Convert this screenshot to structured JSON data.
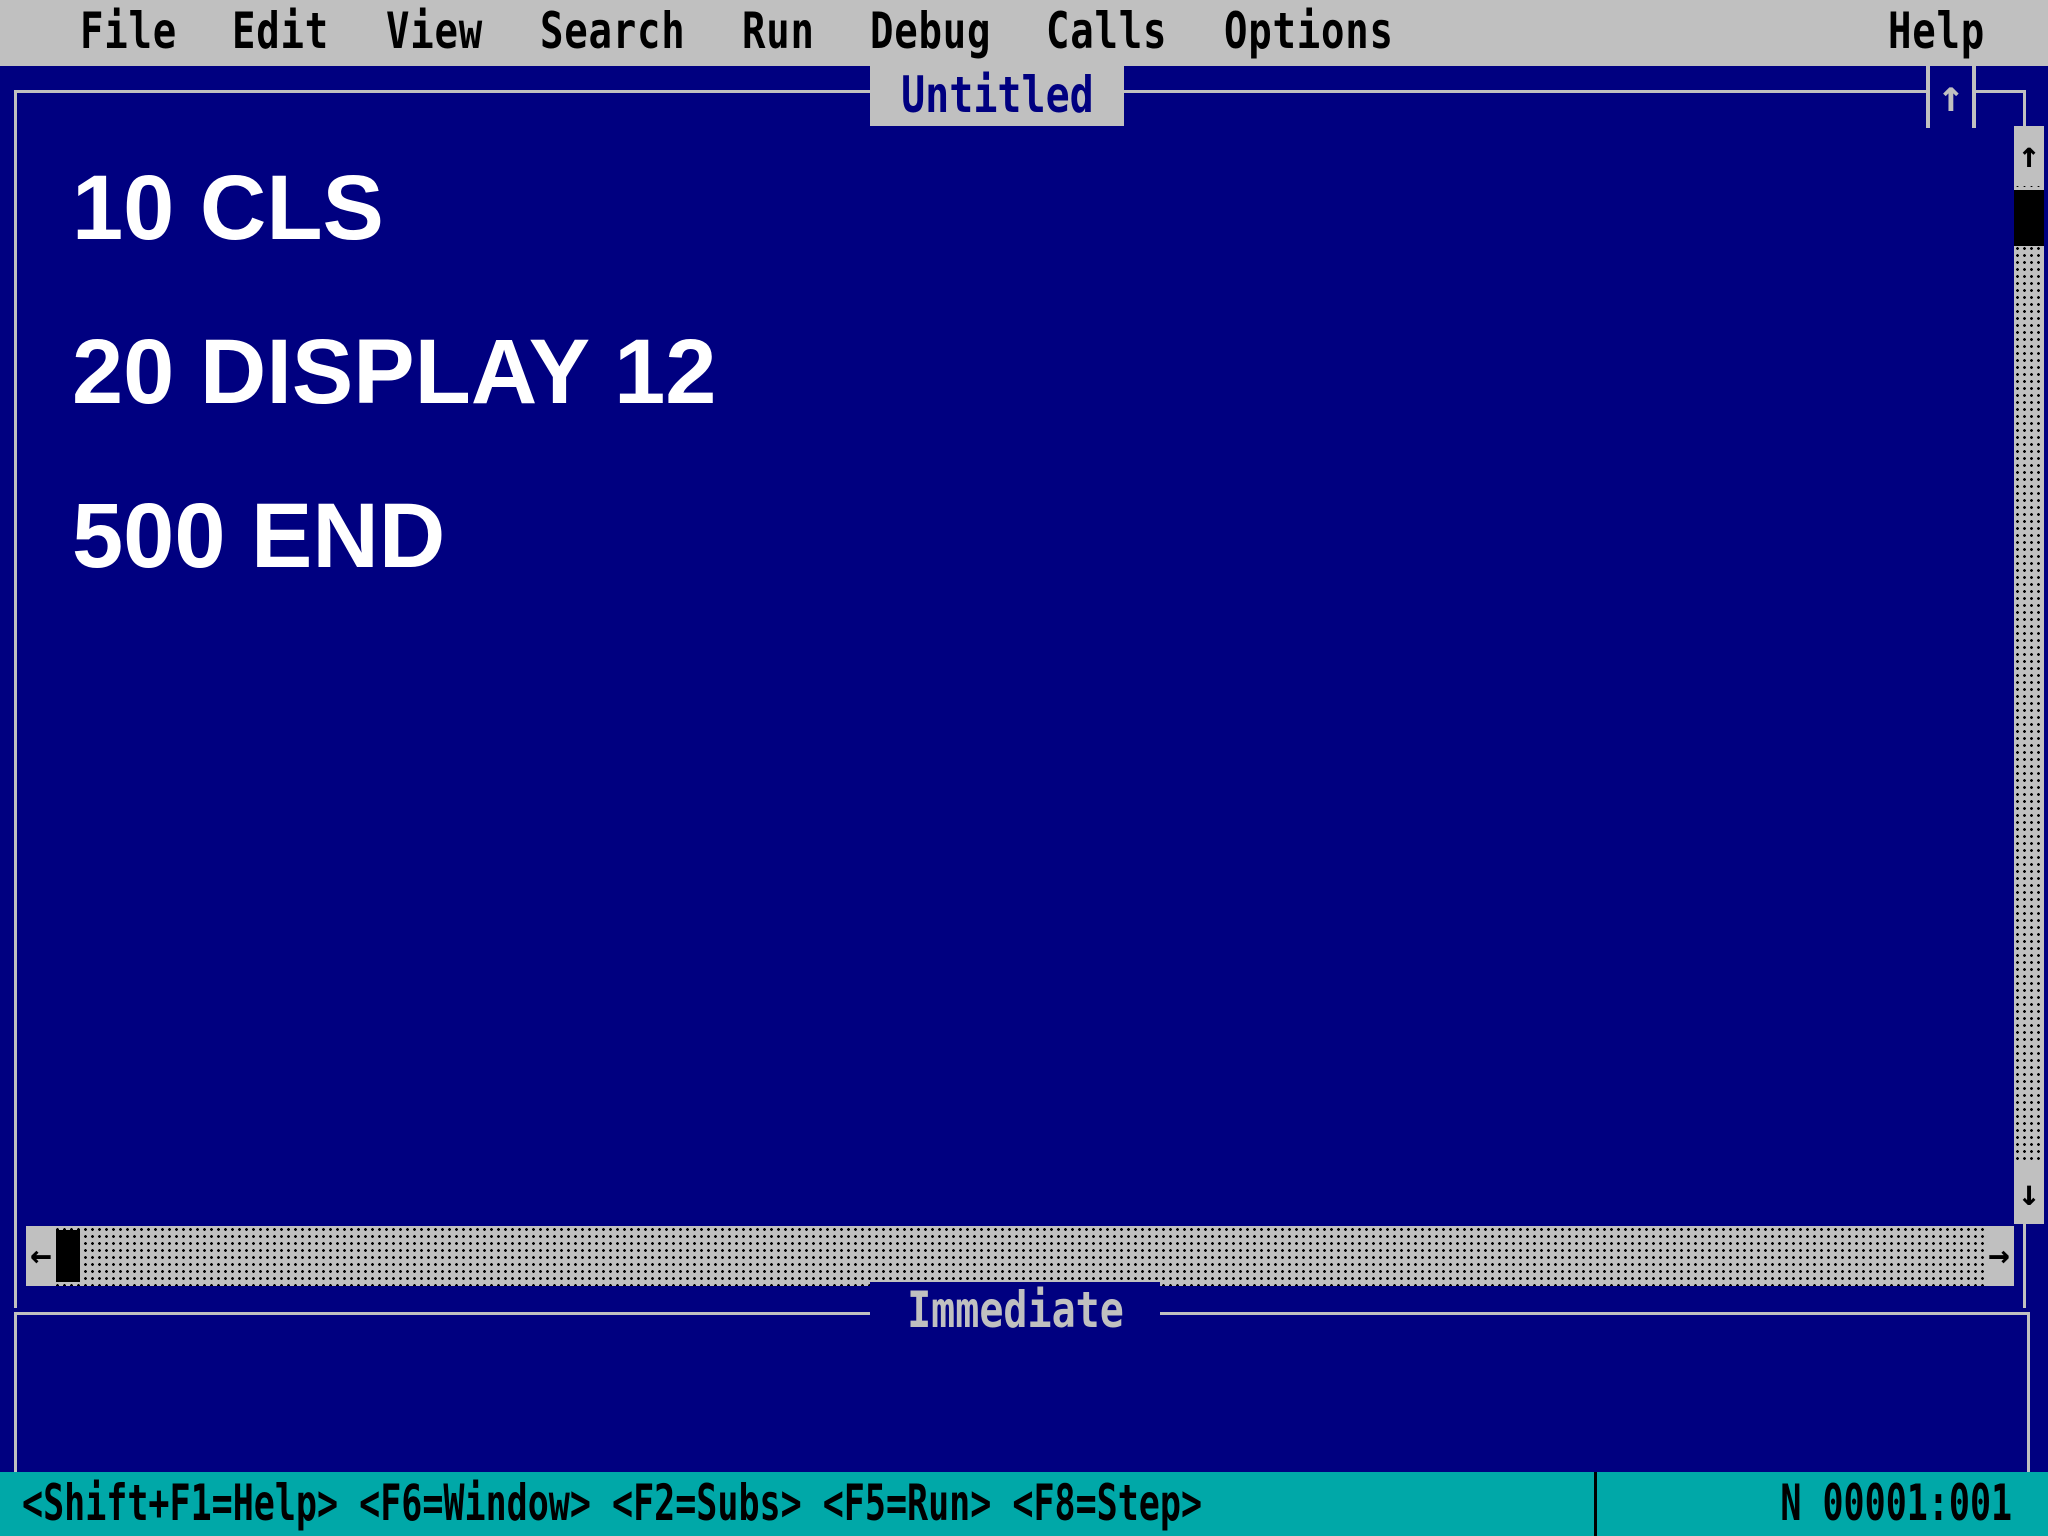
{
  "menu": {
    "items": [
      "File",
      "Edit",
      "View",
      "Search",
      "Run",
      "Debug",
      "Calls",
      "Options"
    ],
    "help": "Help"
  },
  "editor": {
    "title": "Untitled",
    "maximize_glyph": "↑",
    "lines": [
      "10 CLS",
      "20 DISPLAY 12",
      "500 END"
    ]
  },
  "scrollbars": {
    "up_glyph": "↑",
    "down_glyph": "↓",
    "left_glyph": "←",
    "right_glyph": "→"
  },
  "immediate": {
    "title": "Immediate"
  },
  "status": {
    "keys": "<Shift+F1=Help> <F6=Window> <F2=Subs> <F5=Run> <F8=Step>",
    "position": "N 00001:001"
  },
  "colors": {
    "background": "#000080",
    "menu_bar": "#c0c0c0",
    "status_bar": "#00a8a8",
    "code_text": "#ffffff"
  }
}
